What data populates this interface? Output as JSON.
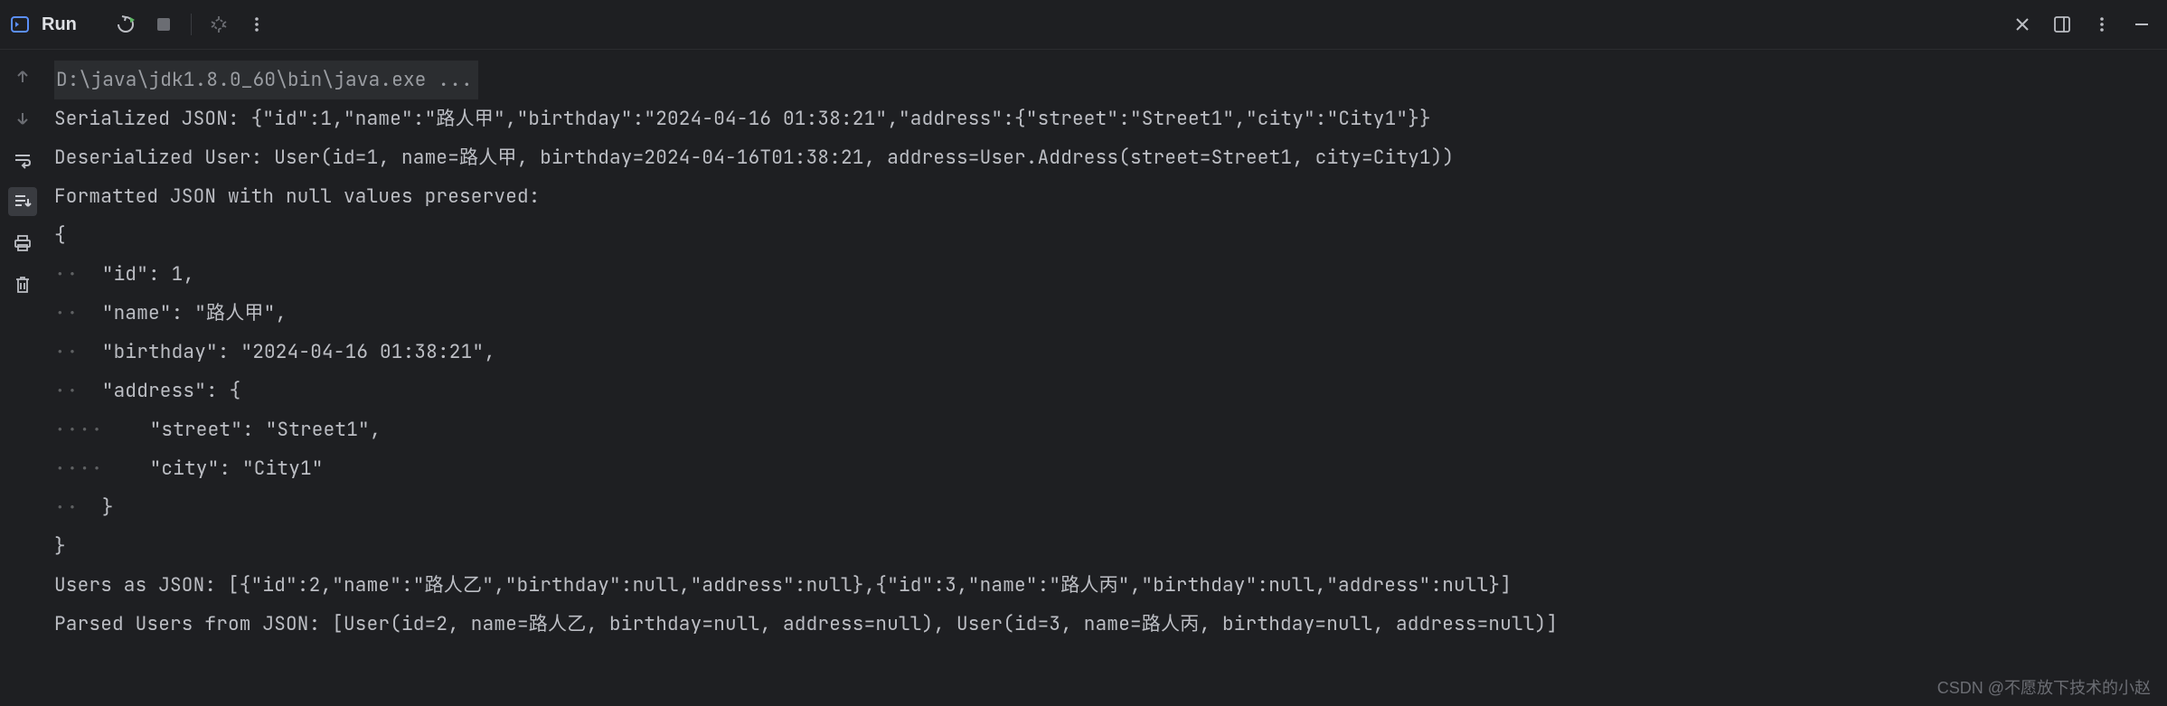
{
  "header": {
    "title": "Run"
  },
  "console": {
    "cmd": "D:\\java\\jdk1.8.0_60\\bin\\java.exe ...",
    "line1": "Serialized JSON: {\"id\":1,\"name\":\"路人甲\",\"birthday\":\"2024-04-16 01:38:21\",\"address\":{\"street\":\"Street1\",\"city\":\"City1\"}}",
    "line2": "Deserialized User: User(id=1, name=路人甲, birthday=2024-04-16T01:38:21, address=User.Address(street=Street1, city=City1))",
    "line3": "Formatted JSON with null values preserved:",
    "json_block": {
      "l0": "{",
      "l1": "  \"id\": 1,",
      "l2": "  \"name\": \"路人甲\",",
      "l3": "  \"birthday\": \"2024-04-16 01:38:21\",",
      "l4": "  \"address\": {",
      "l5": "    \"street\": \"Street1\",",
      "l6": "    \"city\": \"City1\"",
      "l7": "  }",
      "l8": "}"
    },
    "line4": "Users as JSON: [{\"id\":2,\"name\":\"路人乙\",\"birthday\":null,\"address\":null},{\"id\":3,\"name\":\"路人丙\",\"birthday\":null,\"address\":null}]",
    "line5": "Parsed Users from JSON: [User(id=2, name=路人乙, birthday=null, address=null), User(id=3, name=路人丙, birthday=null, address=null)]"
  },
  "watermark": "CSDN @不愿放下技术的小赵",
  "indent_dots": {
    "d2": "··",
    "d4": "····"
  }
}
